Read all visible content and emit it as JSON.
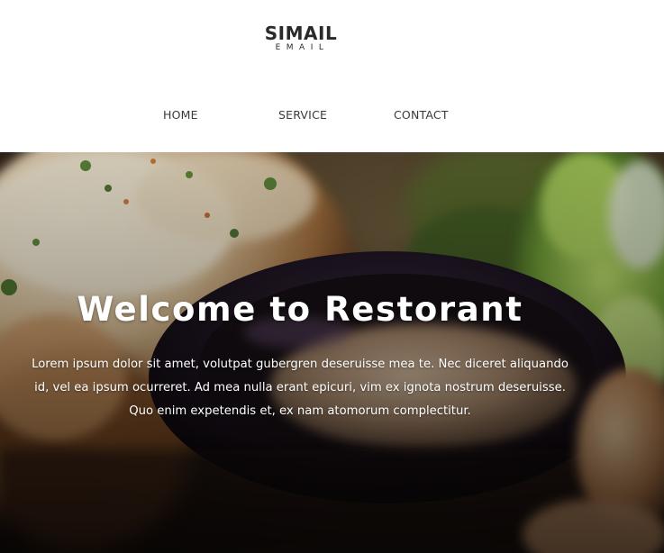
{
  "header": {
    "logo": {
      "title": "SIMAIL",
      "subtitle": "EMAIL"
    },
    "nav": [
      {
        "label": "HOME"
      },
      {
        "label": "SERVICE"
      },
      {
        "label": "CONTACT"
      }
    ]
  },
  "hero": {
    "title": "Welcome to Restorant",
    "text": "Lorem ipsum dolor sit amet, volutpat gubergren deseruisse mea te. Nec diceret aliquando id, vel ea ipsum ocurreret. Ad mea nulla erant epicuri, vim ex ignota nostrum deseruisse. Quo enim expetendis et, ex nam atomorum complectitur.",
    "image": "food-photo",
    "text_color": "#ffffff"
  },
  "colors": {
    "header_background": "#ffffff",
    "nav_text": "#3a3a3a",
    "logo_text": "#2a2a2a"
  }
}
